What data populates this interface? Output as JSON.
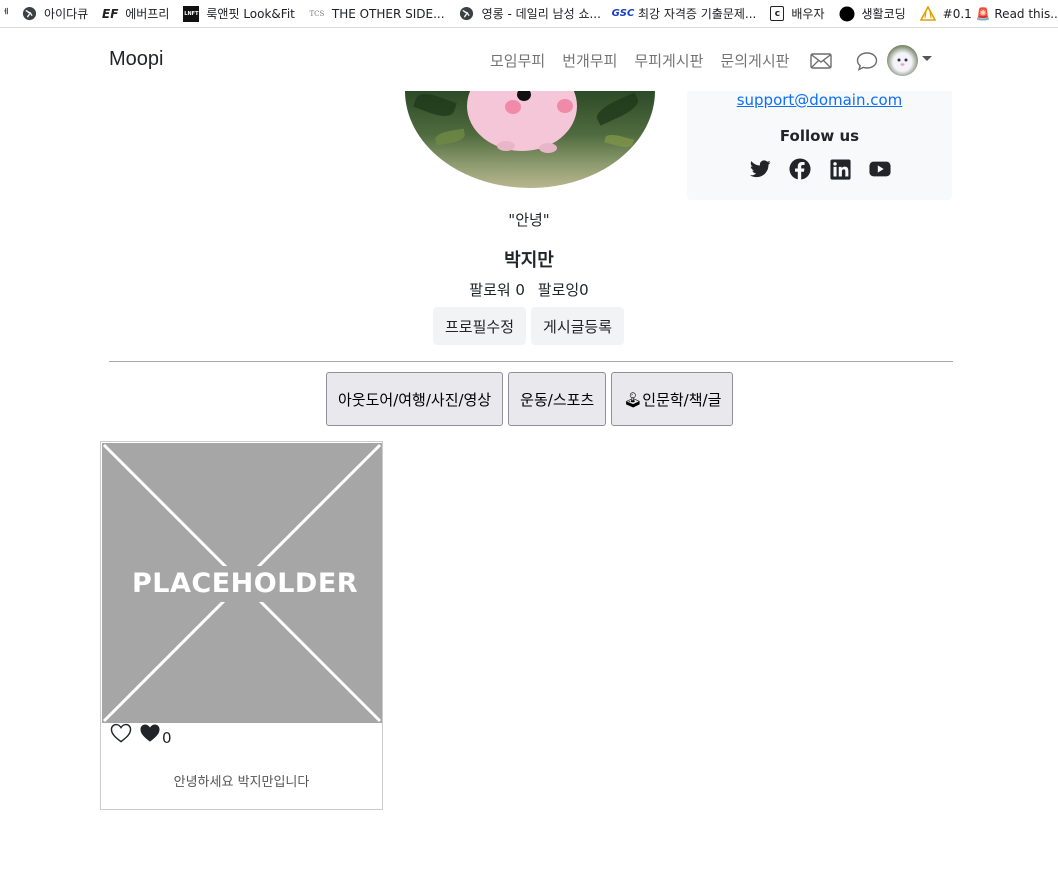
{
  "bookmarks": [
    {
      "label": "아이다큐",
      "icon": "globe-icon"
    },
    {
      "label": "에버프리",
      "icon": "ef-logo-icon"
    },
    {
      "label": "룩앤핏 Look&Fit",
      "icon": "lnft-logo-icon"
    },
    {
      "label": "THE OTHER SIDE...",
      "icon": "tcs-logo-icon"
    },
    {
      "label": "영롱 - 데일리 남성 쇼...",
      "icon": "globe-icon"
    },
    {
      "label": "최강 자격증 기출문제...",
      "icon": "gsc-logo-icon"
    },
    {
      "label": "배우자",
      "icon": "c-logo-icon"
    },
    {
      "label": "생활코딩",
      "icon": "black-circle-icon"
    },
    {
      "label": "#0.1 🚨 Read this...",
      "icon": "warning-icon"
    }
  ],
  "navbar": {
    "brand": "Moopi",
    "links": [
      "모임무피",
      "번개무피",
      "무피게시판",
      "문의게시판"
    ]
  },
  "sidebar": {
    "email": "support@domain.com",
    "follow_title": "Follow us",
    "social": [
      "twitter-icon",
      "facebook-icon",
      "linkedin-icon",
      "youtube-icon"
    ]
  },
  "profile": {
    "status": "\"안녕\"",
    "name": "박지만",
    "followers_label": "팔로워 0",
    "following_label": "팔로잉0",
    "edit_button": "프로필수정",
    "post_button": "게시글등록"
  },
  "categories": [
    "아웃도어/여행/사진/영상",
    "운동/스포츠",
    "🕹인문학/책/글"
  ],
  "posts": [
    {
      "image_text": "PLACEHOLDER",
      "like_count": "0",
      "text": "안녕하세요 박지만입니다"
    }
  ]
}
